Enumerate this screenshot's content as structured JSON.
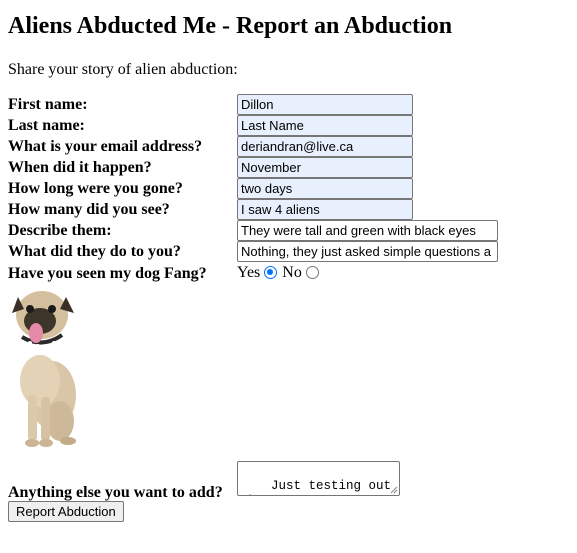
{
  "page": {
    "heading": "Aliens Abducted Me - Report an Abduction",
    "intro": "Share your story of alien abduction:"
  },
  "form": {
    "fields": [
      {
        "label": "First name:",
        "value": "Dillon"
      },
      {
        "label": "Last name:",
        "value": "Last Name"
      },
      {
        "label": "What is your email address?",
        "value": "deriandran@live.ca"
      },
      {
        "label": "When did it happen?",
        "value": "November"
      },
      {
        "label": "How long were you gone?",
        "value": "two days"
      },
      {
        "label": "How many did you see?",
        "value": "I saw 4 aliens"
      },
      {
        "label": "Describe them:",
        "value": "They were tall and green with black eyes"
      },
      {
        "label": "What did they do to you?",
        "value": "Nothing, they just asked simple questions a"
      }
    ],
    "fang": {
      "label": "Have you seen my dog Fang?",
      "yes_label": "Yes",
      "no_label": "No",
      "selected": "Yes"
    },
    "other": {
      "label": "Anything else you want to add?",
      "value": "Just testing out the\ninformation"
    },
    "submit_label": "Report Abduction"
  },
  "icons": {
    "dog": "pug-dog-image",
    "resize": "resize-grip-icon"
  },
  "colors": {
    "autofill_bg": "#e8f0fe",
    "radio_accent": "#0075ff",
    "button_bg": "#efefef"
  }
}
